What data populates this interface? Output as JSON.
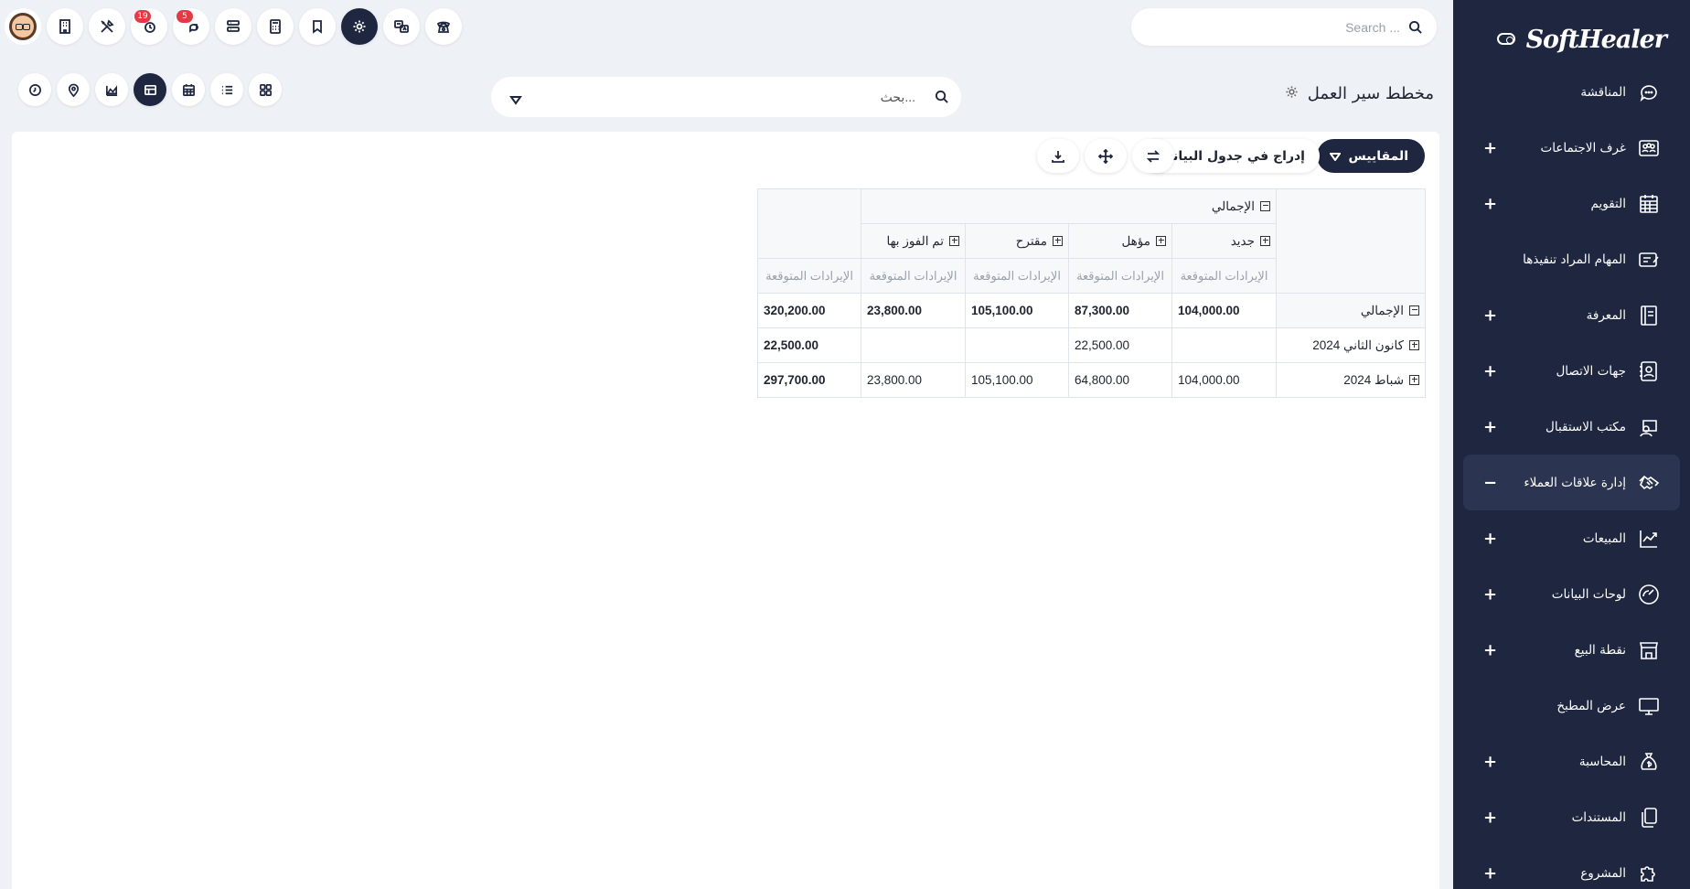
{
  "sidebar": {
    "logo": "SoftHealer",
    "items": [
      {
        "label": "المناقشة",
        "icon": "chat-icon",
        "expandable": false,
        "active": false
      },
      {
        "label": "غرف الاجتماعات",
        "icon": "meeting-room-icon",
        "expandable": true,
        "active": false
      },
      {
        "label": "التقويم",
        "icon": "calendar-icon",
        "expandable": true,
        "active": false
      },
      {
        "label": "المهام المراد تنفيذها",
        "icon": "todo-icon",
        "expandable": false,
        "active": false
      },
      {
        "label": "المعرفة",
        "icon": "knowledge-icon",
        "expandable": true,
        "active": false
      },
      {
        "label": "جهات الاتصال",
        "icon": "contacts-icon",
        "expandable": true,
        "active": false
      },
      {
        "label": "مكتب الاستقبال",
        "icon": "frontdesk-icon",
        "expandable": true,
        "active": false
      },
      {
        "label": "إدارة علاقات العملاء",
        "icon": "handshake-icon",
        "expandable": true,
        "active": true
      },
      {
        "label": "المبيعات",
        "icon": "sales-chart-icon",
        "expandable": true,
        "active": false
      },
      {
        "label": "لوحات البيانات",
        "icon": "dashboard-icon",
        "expandable": true,
        "active": false
      },
      {
        "label": "نقطة البيع",
        "icon": "store-icon",
        "expandable": true,
        "active": false
      },
      {
        "label": "عرض المطبخ",
        "icon": "monitor-icon",
        "expandable": false,
        "active": false
      },
      {
        "label": "المحاسبة",
        "icon": "money-bag-icon",
        "expandable": true,
        "active": false
      },
      {
        "label": "المستندات",
        "icon": "documents-icon",
        "expandable": true,
        "active": false
      },
      {
        "label": "المشروع",
        "icon": "puzzle-icon",
        "expandable": true,
        "active": false
      }
    ],
    "plus_symbol": "+",
    "minus_symbol": "−"
  },
  "topbar": {
    "search_placeholder": "Search ...",
    "badges": {
      "activities": "19",
      "messages": "5"
    }
  },
  "control_panel": {
    "title": "مخطط سير العمل",
    "search_value": "",
    "search_placeholder": "بحث..."
  },
  "pivot": {
    "measures_label": "المقاييس",
    "insert_label": "إدراج في جدول البيانات",
    "col_total": "الإجمالي",
    "col_groups": [
      "جديد",
      "مؤهل",
      "مقترح",
      "تم الفوز بها"
    ],
    "measure": "الإيرادات المتوقعة",
    "row_total": "الإجمالي",
    "rows": [
      {
        "label": "الإجمالي",
        "values": [
          "104,000.00",
          "87,300.00",
          "105,100.00",
          "23,800.00"
        ],
        "total": "320,200.00",
        "is_total": true
      },
      {
        "label": "كانون الثاني 2024",
        "values": [
          "",
          "22,500.00",
          "",
          ""
        ],
        "total": "22,500.00",
        "is_total": false
      },
      {
        "label": "شباط 2024",
        "values": [
          "104,000.00",
          "64,800.00",
          "105,100.00",
          "23,800.00"
        ],
        "total": "297,700.00",
        "is_total": false
      }
    ]
  },
  "colors": {
    "sidebar_bg": "#1e2640",
    "accent": "#1e2640",
    "badge": "#e53945",
    "page_bg": "#eef1f6"
  }
}
